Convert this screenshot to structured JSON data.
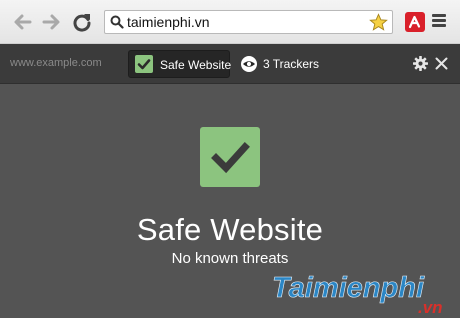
{
  "browser": {
    "address": "taimienphi.vn",
    "icons": [
      "arrow-left-icon",
      "arrow-right-icon",
      "reload-icon",
      "search-icon",
      "star-icon",
      "avira-icon",
      "menu-icon"
    ]
  },
  "popup": {
    "domain": "www.example.com",
    "tabs": {
      "safe_label": "Safe Website",
      "trackers_label": "3 Trackers"
    },
    "status_title": "Safe Website",
    "status_subtitle": "No known threats",
    "accent_color": "#8cc47f",
    "icons": [
      "check-icon",
      "eye-icon",
      "gear-icon",
      "close-icon"
    ]
  },
  "watermark": {
    "main": "Taimienphi",
    "suffix": ".vn"
  }
}
